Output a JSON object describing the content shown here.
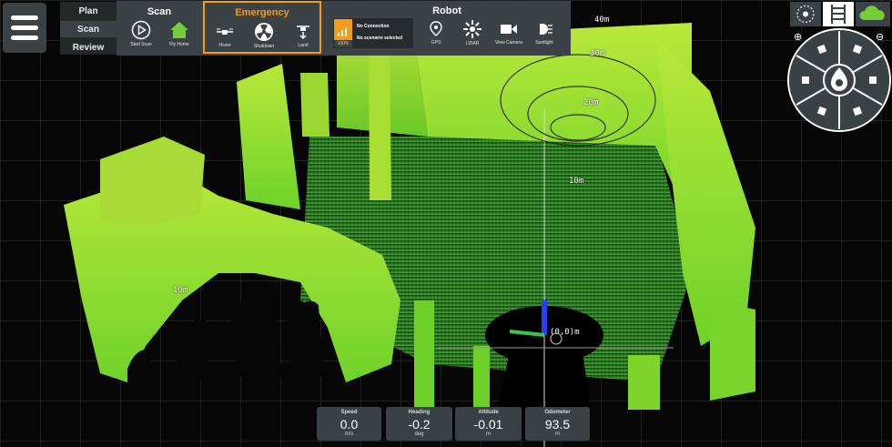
{
  "modes": [
    {
      "label": "Plan"
    },
    {
      "label": "Scan"
    },
    {
      "label": "Review"
    }
  ],
  "scan": {
    "title": "Scan",
    "start_scan": "Start Scan",
    "fly_home": "Fly Home"
  },
  "emergency": {
    "title": "Emergency",
    "hover": "Hover",
    "shutdown": "Shutdown",
    "land": "Land"
  },
  "robot": {
    "title": "Robot",
    "connection": "No Connection",
    "scenario": "No scenario selected",
    "signal_percent": "100%",
    "gps": "GPS",
    "lidar": "LIDAR",
    "view_camera": "View Camera",
    "spotlight": "Spotlight"
  },
  "map_labels": {
    "r40": "40m",
    "r30": "30m",
    "r20": "20m",
    "r10a": "10m",
    "r10b": "10m",
    "origin": "(0,0)m"
  },
  "telemetry": {
    "speed": {
      "label": "Speed",
      "value": "0.0",
      "unit": "m/s"
    },
    "heading": {
      "label": "Heading",
      "value": "-0.2",
      "unit": "deg"
    },
    "altitude": {
      "label": "Altitude",
      "value": "-0.01",
      "unit": "m"
    },
    "odometer": {
      "label": "Odometer",
      "value": "93.5",
      "unit": "m"
    }
  },
  "colors": {
    "accent": "#f39c1c",
    "point_cloud": "#8fe02a",
    "panel": "#3b4246"
  }
}
